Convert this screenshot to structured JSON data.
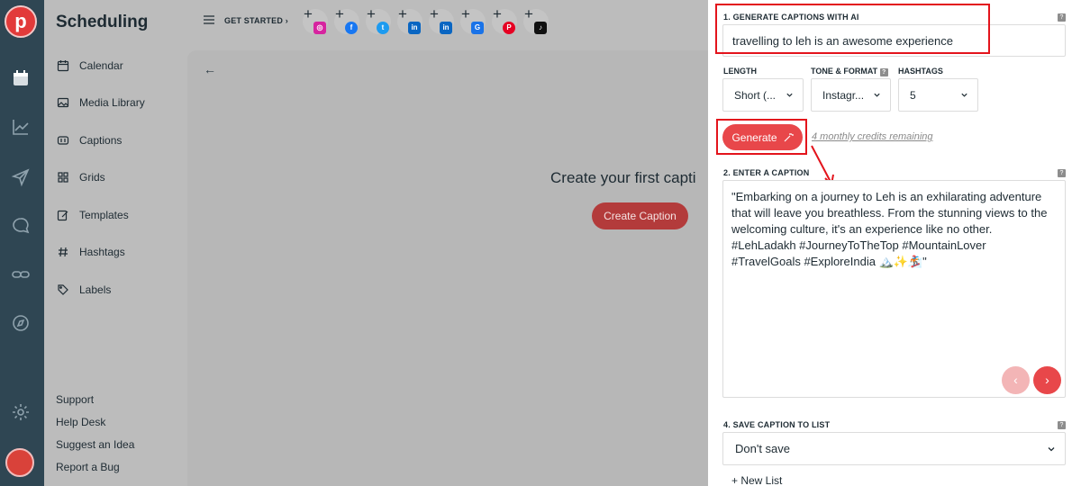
{
  "app": {
    "logo_letter": "p",
    "section_title": "Scheduling"
  },
  "sidebar": {
    "items": [
      {
        "label": "Calendar",
        "icon": "calendar-icon"
      },
      {
        "label": "Media Library",
        "icon": "image-icon"
      },
      {
        "label": "Captions",
        "icon": "caption-icon"
      },
      {
        "label": "Grids",
        "icon": "grid-icon"
      },
      {
        "label": "Templates",
        "icon": "edit-icon"
      },
      {
        "label": "Hashtags",
        "icon": "hashtag-icon"
      },
      {
        "label": "Labels",
        "icon": "tag-icon"
      }
    ],
    "bottom_links": [
      "Support",
      "Help Desk",
      "Suggest an Idea",
      "Report a Bug"
    ]
  },
  "header": {
    "get_started": "GET STARTED",
    "social_accounts": [
      {
        "icon": "instagram-icon",
        "color": "#d6249f"
      },
      {
        "icon": "facebook-icon",
        "color": "#1877f2"
      },
      {
        "icon": "twitter-icon",
        "color": "#1d9bf0"
      },
      {
        "icon": "linkedin-icon",
        "color": "#0a66c2"
      },
      {
        "icon": "linkedin-icon",
        "color": "#0a66c2"
      },
      {
        "icon": "google-business-icon",
        "color": "#1a73e8"
      },
      {
        "icon": "pinterest-icon",
        "color": "#e60023"
      },
      {
        "icon": "tiktok-icon",
        "color": "#111111"
      }
    ]
  },
  "main": {
    "empty_title": "Create your first capti",
    "create_button": "Create Caption"
  },
  "panel": {
    "section1_label": "1. GENERATE CAPTIONS WITH AI",
    "prompt_value": "travelling to leh is an awesome experience",
    "length_label": "LENGTH",
    "length_value": "Short (...",
    "tone_label": "TONE & FORMAT",
    "tone_value": "Instagr...",
    "hashtags_label": "HASHTAGS",
    "hashtags_value": "5",
    "generate_label": "Generate",
    "credits_text": "4 monthly credits remaining",
    "section2_label": "2. ENTER A CAPTION",
    "caption_text": "\"Embarking on a journey to Leh is an exhilarating adventure that will leave you breathless. From the stunning views to the welcoming culture, it's an experience like no other. #LehLadakh #JourneyToTheTop #MountainLover #TravelGoals #ExploreIndia 🏔️✨🏂\"",
    "section4_label": "4. SAVE CAPTION TO LIST",
    "save_value": "Don't save",
    "new_list_label": "+ New List",
    "help_glyph": "?",
    "prev_glyph": "‹",
    "next_glyph": "›"
  },
  "colors": {
    "accent": "#e8474a",
    "annotation_red": "#e3141c",
    "rail_bg": "#2f4653"
  }
}
